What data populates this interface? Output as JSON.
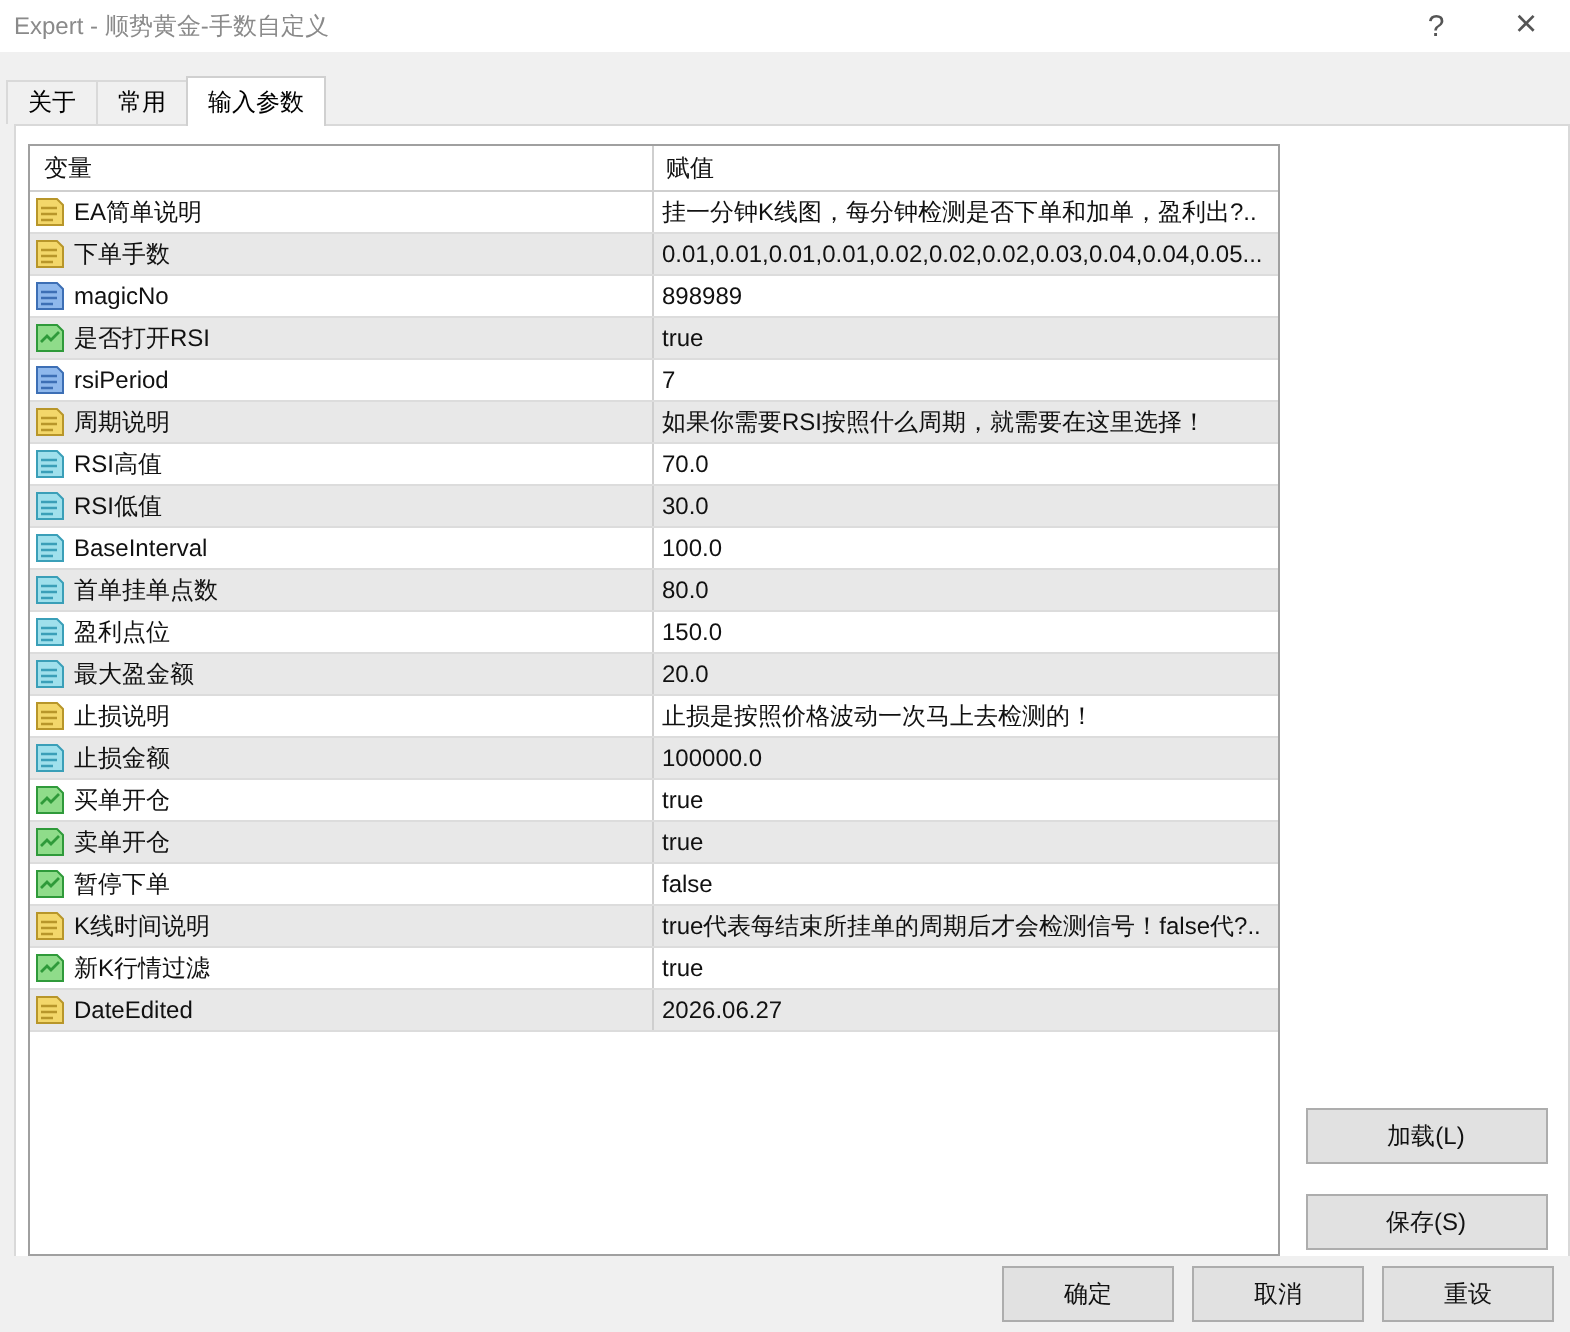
{
  "window": {
    "title": "Expert - 顺势黄金-手数自定义",
    "help": "?",
    "close": "×"
  },
  "tabs": [
    {
      "label": "关于",
      "selected": false
    },
    {
      "label": "常用",
      "selected": false
    },
    {
      "label": "输入参数",
      "selected": true
    }
  ],
  "table": {
    "columns": [
      "变量",
      "赋值"
    ],
    "rows": [
      {
        "kind": "string",
        "name": "EA简单说明",
        "value": "挂一分钟K线图，每分钟检测是否下单和加单，盈利出?.."
      },
      {
        "kind": "string",
        "name": "下单手数",
        "value": "0.01,0.01,0.01,0.01,0.02,0.02,0.02,0.03,0.04,0.04,0.05..."
      },
      {
        "kind": "int",
        "name": "magicNo",
        "value": "898989"
      },
      {
        "kind": "bool",
        "name": "是否打开RSI",
        "value": "true"
      },
      {
        "kind": "int",
        "name": "rsiPeriod",
        "value": "7"
      },
      {
        "kind": "string",
        "name": "周期说明",
        "value": "如果你需要RSI按照什么周期，就需要在这里选择！"
      },
      {
        "kind": "double",
        "name": "RSI高值",
        "value": "70.0"
      },
      {
        "kind": "double",
        "name": "RSI低值",
        "value": "30.0"
      },
      {
        "kind": "double",
        "name": "BaseInterval",
        "value": "100.0"
      },
      {
        "kind": "double",
        "name": "首单挂单点数",
        "value": "80.0"
      },
      {
        "kind": "double",
        "name": "盈利点位",
        "value": "150.0"
      },
      {
        "kind": "double",
        "name": "最大盈金额",
        "value": "20.0"
      },
      {
        "kind": "string",
        "name": "止损说明",
        "value": "止损是按照价格波动一次马上去检测的！"
      },
      {
        "kind": "double",
        "name": "止损金额",
        "value": "100000.0"
      },
      {
        "kind": "bool",
        "name": "买单开仓",
        "value": "true"
      },
      {
        "kind": "bool",
        "name": "卖单开仓",
        "value": "true"
      },
      {
        "kind": "bool",
        "name": "暂停下单",
        "value": "false"
      },
      {
        "kind": "string",
        "name": "K线时间说明",
        "value": "true代表每结束所挂单的周期后才会检测信号！false代?.."
      },
      {
        "kind": "bool",
        "name": "新K行情过滤",
        "value": "true"
      },
      {
        "kind": "string",
        "name": "DateEdited",
        "value": "2026.06.27"
      }
    ]
  },
  "side_buttons": [
    "加载(L)",
    "保存(S)"
  ],
  "buttons": [
    "确定",
    "取消",
    "重设"
  ]
}
